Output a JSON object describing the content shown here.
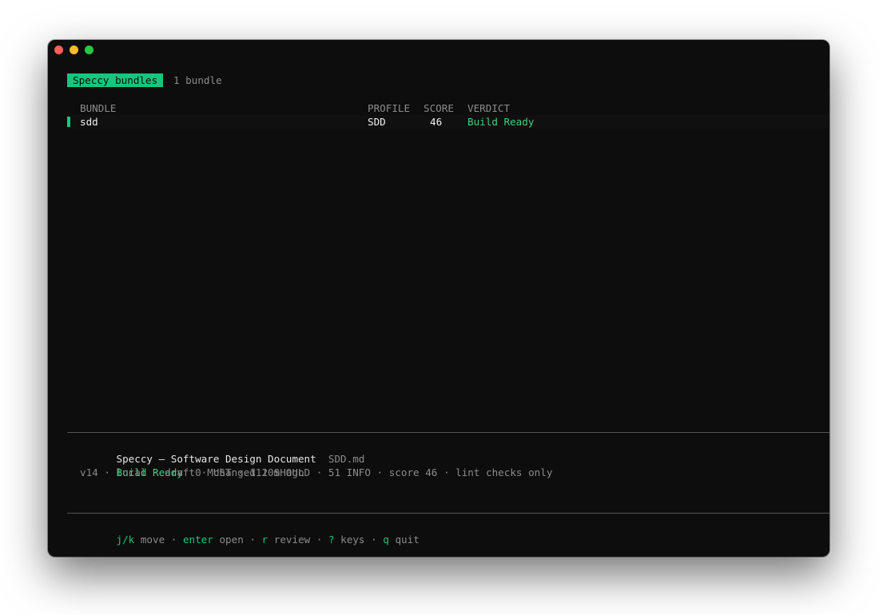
{
  "window": {
    "lights": {
      "close": "#ff5f57",
      "minimize": "#febc2e",
      "zoom": "#28c840"
    }
  },
  "header": {
    "badge": "Speccy bundles",
    "count": "1 bundle"
  },
  "table": {
    "columns": [
      "BUNDLE",
      "PROFILE",
      "SCORE",
      "VERDICT"
    ],
    "rows": [
      {
        "bundle": "sdd",
        "profile": "SDD",
        "score": "46",
        "verdict": "Build Ready"
      }
    ]
  },
  "detail": {
    "title": "Speccy — Software Design Document",
    "file": "SDD.md",
    "verdict": "Build Ready",
    "stats": "0 MUST · 111 SHOULD · 51 INFO · score 46 · lint checks only",
    "meta": "v14 · local · draft · changed 20m ago"
  },
  "footer": {
    "keys": [
      {
        "key": "j/k",
        "action": "move"
      },
      {
        "key": "enter",
        "action": "open"
      },
      {
        "key": "r",
        "action": "review"
      },
      {
        "key": "?",
        "action": "keys"
      },
      {
        "key": "q",
        "action": "quit"
      }
    ],
    "separator": " · "
  },
  "colors": {
    "accent": "#13c77f",
    "verdict_ok": "#3fd07e",
    "background": "#0d0d0d"
  }
}
